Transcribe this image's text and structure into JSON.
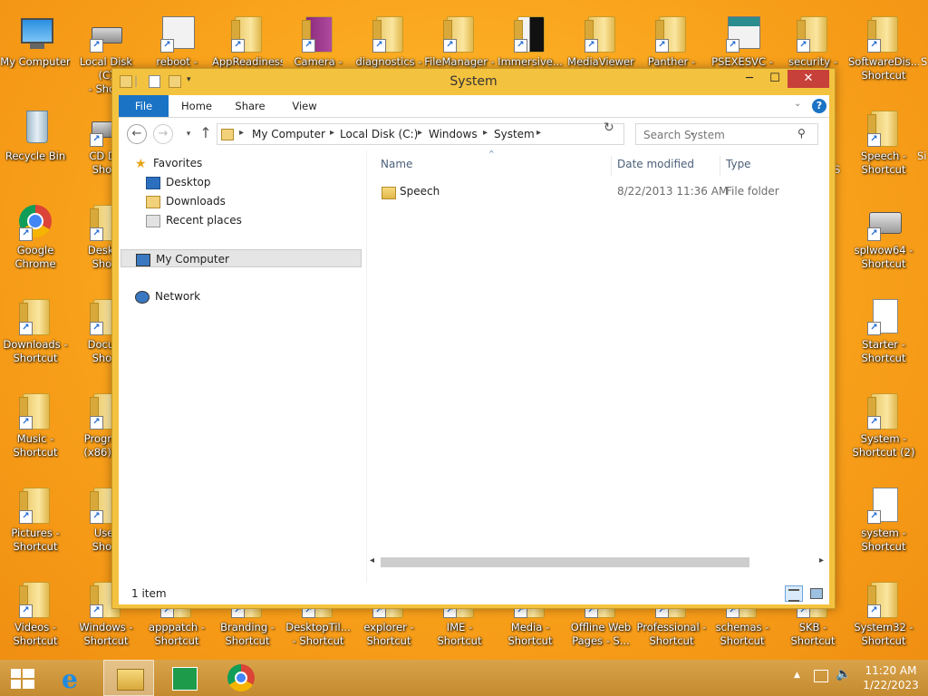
{
  "desktop": {
    "icons": [
      {
        "label": "My Computer",
        "type": "pc"
      },
      {
        "label": "Local Disk (C)\n- Short",
        "type": "disk"
      },
      {
        "label": "reboot -",
        "type": "app"
      },
      {
        "label": "AppReadiness",
        "type": "folder"
      },
      {
        "label": "Camera -",
        "type": "folder"
      },
      {
        "label": "diagnostics -",
        "type": "folder"
      },
      {
        "label": "FileManager -",
        "type": "folder"
      },
      {
        "label": "Immersive...",
        "type": "folder"
      },
      {
        "label": "MediaViewer",
        "type": "folder"
      },
      {
        "label": "Panther -",
        "type": "folder"
      },
      {
        "label": "PSEXESVC -",
        "type": "app"
      },
      {
        "label": "security -",
        "type": "folder"
      },
      {
        "label": "SoftwareDis...\nShortcut",
        "type": "folder"
      },
      {
        "label": "Recycle Bin",
        "type": "bin"
      },
      {
        "label": "CD Dri\nShort",
        "type": "disk"
      },
      {
        "label": "Speech -\nShortcut",
        "type": "folder"
      },
      {
        "label": "Google\nChrome",
        "type": "chrome"
      },
      {
        "label": "Deskto\nShort",
        "type": "folder"
      },
      {
        "label": "splwow64 -\nShortcut",
        "type": "printer"
      },
      {
        "label": "Downloads -\nShortcut",
        "type": "folder"
      },
      {
        "label": "Docum\nShort",
        "type": "folder"
      },
      {
        "label": "Starter -\nShortcut",
        "type": "doc"
      },
      {
        "label": "Music -\nShortcut",
        "type": "folder"
      },
      {
        "label": "Program\n(x86) - S",
        "type": "folder"
      },
      {
        "label": "System -\nShortcut (2)",
        "type": "folder"
      },
      {
        "label": "Pictures -\nShortcut",
        "type": "folder"
      },
      {
        "label": "User\nShort",
        "type": "folder"
      },
      {
        "label": "system -\nShortcut",
        "type": "doc"
      },
      {
        "label": "Videos -\nShortcut",
        "type": "folder"
      },
      {
        "label": "Windows -\nShortcut",
        "type": "folder"
      },
      {
        "label": "apppatch -\nShortcut",
        "type": "folder"
      },
      {
        "label": "Branding -\nShortcut",
        "type": "folder"
      },
      {
        "label": "DesktopTil...\n- Shortcut",
        "type": "folder"
      },
      {
        "label": "explorer -\nShortcut",
        "type": "folder"
      },
      {
        "label": "IME -\nShortcut",
        "type": "folder"
      },
      {
        "label": "Media -\nShortcut",
        "type": "folder"
      },
      {
        "label": "Offline Web\nPages - S...",
        "type": "folder"
      },
      {
        "label": "Professional -\nShortcut",
        "type": "folder"
      },
      {
        "label": "schemas -\nShortcut",
        "type": "folder"
      },
      {
        "label": "SKB -\nShortcut",
        "type": "folder"
      },
      {
        "label": "System32 -\nShortcut",
        "type": "folder"
      }
    ],
    "partial_icons": [
      "S",
      "Si",
      "S"
    ]
  },
  "window": {
    "title": "System",
    "ribbon_tabs": {
      "file": "File",
      "home": "Home",
      "share": "Share",
      "view": "View"
    },
    "breadcrumbs": [
      "My Computer",
      "Local Disk (C:)",
      "Windows",
      "System"
    ],
    "search_placeholder": "Search System",
    "nav": {
      "favorites": "Favorites",
      "desktop": "Desktop",
      "downloads": "Downloads",
      "recent": "Recent places",
      "mycomputer": "My Computer",
      "network": "Network"
    },
    "columns": {
      "name": "Name",
      "date": "Date modified",
      "type": "Type"
    },
    "files": [
      {
        "name": "Speech",
        "date": "8/22/2013 11:36 AM",
        "type": "File folder"
      }
    ],
    "status": "1 item"
  },
  "taskbar": {
    "clock_time": "11:20 AM",
    "clock_date": "1/22/2023"
  }
}
